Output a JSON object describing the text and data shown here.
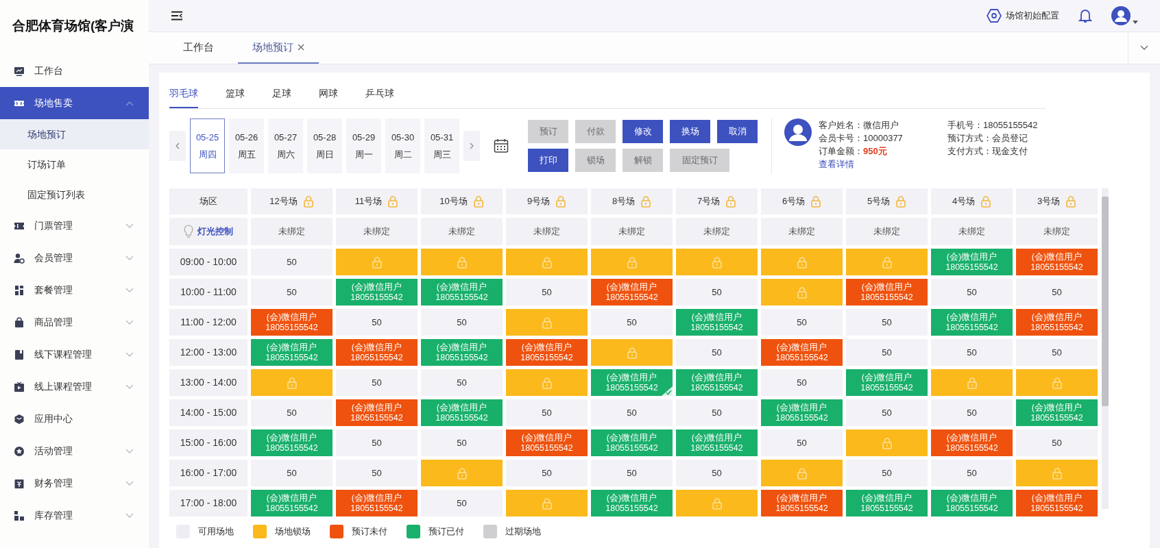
{
  "sidebar": {
    "title": "合肥体育场馆(客户演",
    "items": [
      {
        "label": "工作台",
        "kind": "link",
        "selected": false
      },
      {
        "label": "场地售卖",
        "kind": "group",
        "selected": true,
        "expanded": true,
        "children": [
          {
            "label": "场地预订",
            "selected": true
          },
          {
            "label": "订场订单",
            "selected": false
          },
          {
            "label": "固定预订列表",
            "selected": false
          }
        ]
      },
      {
        "label": "门票管理",
        "kind": "group",
        "selected": false,
        "expanded": false
      },
      {
        "label": "会员管理",
        "kind": "group",
        "selected": false,
        "expanded": false
      },
      {
        "label": "套餐管理",
        "kind": "group",
        "selected": false,
        "expanded": false
      },
      {
        "label": "商品管理",
        "kind": "group",
        "selected": false,
        "expanded": false
      },
      {
        "label": "线下课程管理",
        "kind": "group",
        "selected": false,
        "expanded": false
      },
      {
        "label": "线上课程管理",
        "kind": "group",
        "selected": false,
        "expanded": false
      },
      {
        "label": "应用中心",
        "kind": "link",
        "selected": false
      },
      {
        "label": "活动管理",
        "kind": "group",
        "selected": false,
        "expanded": false
      },
      {
        "label": "财务管理",
        "kind": "group",
        "selected": false,
        "expanded": false
      },
      {
        "label": "库存管理",
        "kind": "group",
        "selected": false,
        "expanded": false
      }
    ]
  },
  "header": {
    "settings_label": "场馆初始配置"
  },
  "tabs": [
    {
      "label": "工作台",
      "selected": false,
      "closable": false
    },
    {
      "label": "场地预订",
      "selected": true,
      "closable": true
    }
  ],
  "sport_tabs": [
    {
      "label": "羽毛球",
      "selected": true
    },
    {
      "label": "篮球",
      "selected": false
    },
    {
      "label": "足球",
      "selected": false
    },
    {
      "label": "网球",
      "selected": false
    },
    {
      "label": "乒乓球",
      "selected": false
    }
  ],
  "dates": [
    {
      "date": "05-25",
      "weekday": "周四",
      "selected": true
    },
    {
      "date": "05-26",
      "weekday": "周五",
      "selected": false
    },
    {
      "date": "05-27",
      "weekday": "周六",
      "selected": false
    },
    {
      "date": "05-28",
      "weekday": "周日",
      "selected": false
    },
    {
      "date": "05-29",
      "weekday": "周一",
      "selected": false
    },
    {
      "date": "05-30",
      "weekday": "周二",
      "selected": false
    },
    {
      "date": "05-31",
      "weekday": "周三",
      "selected": false
    }
  ],
  "action_rows": [
    [
      {
        "label": "预订",
        "disabled": true
      },
      {
        "label": "付款",
        "disabled": true
      },
      {
        "label": "修改",
        "disabled": false
      },
      {
        "label": "换场",
        "disabled": false
      },
      {
        "label": "取消",
        "disabled": false
      }
    ],
    [
      {
        "label": "打印",
        "disabled": false
      },
      {
        "label": "锁场",
        "disabled": true
      },
      {
        "label": "解锁",
        "disabled": true
      },
      {
        "label": "固定预订",
        "disabled": true
      }
    ]
  ],
  "customer": {
    "fields": [
      {
        "label": "客户姓名：",
        "value": "微信用户",
        "emphasis": false
      },
      {
        "label": "会员卡号：",
        "value": "10000377",
        "emphasis": false
      },
      {
        "label": "订单金额：",
        "value": "950元",
        "emphasis": true
      }
    ],
    "fields_right": [
      {
        "label": "手机号：",
        "value": "18055155542"
      },
      {
        "label": "预订方式：",
        "value": "会员登记"
      },
      {
        "label": "支付方式：",
        "value": "现金支付"
      }
    ],
    "details_link": "查看详情"
  },
  "table": {
    "corner": "场区",
    "courts": [
      "12号场",
      "11号场",
      "10号场",
      "9号场",
      "8号场",
      "7号场",
      "6号场",
      "5号场",
      "4号场",
      "3号场"
    ],
    "light_control": {
      "label": "灯光控制",
      "bindings": [
        "未绑定",
        "未绑定",
        "未绑定",
        "未绑定",
        "未绑定",
        "未绑定",
        "未绑定",
        "未绑定",
        "未绑定",
        "未绑定"
      ]
    },
    "rows": [
      {
        "time": "09:00 - 10:00",
        "cells": [
          {
            "kind": "available",
            "price": "50",
            "selected": false
          },
          {
            "kind": "locked",
            "selected": false
          },
          {
            "kind": "locked",
            "selected": false
          },
          {
            "kind": "locked",
            "selected": false
          },
          {
            "kind": "locked",
            "selected": false
          },
          {
            "kind": "locked",
            "selected": false
          },
          {
            "kind": "locked",
            "selected": false
          },
          {
            "kind": "locked",
            "selected": false
          },
          {
            "kind": "paid",
            "name": "(会)微信用户",
            "phone": "18055155542",
            "selected": false
          },
          {
            "kind": "unpaid",
            "name": "(会)微信用户",
            "phone": "18055155542",
            "selected": false
          }
        ]
      },
      {
        "time": "10:00 - 11:00",
        "cells": [
          {
            "kind": "available",
            "price": "50",
            "selected": false
          },
          {
            "kind": "paid",
            "name": "(会)微信用户",
            "phone": "18055155542",
            "selected": false
          },
          {
            "kind": "paid",
            "name": "(会)微信用户",
            "phone": "18055155542",
            "selected": false
          },
          {
            "kind": "available",
            "price": "50",
            "selected": false
          },
          {
            "kind": "unpaid",
            "name": "(会)微信用户",
            "phone": "18055155542",
            "selected": false
          },
          {
            "kind": "available",
            "price": "50",
            "selected": false
          },
          {
            "kind": "locked",
            "selected": false
          },
          {
            "kind": "unpaid",
            "name": "(会)微信用户",
            "phone": "18055155542",
            "selected": false
          },
          {
            "kind": "available",
            "price": "50",
            "selected": false
          },
          {
            "kind": "available",
            "price": "50",
            "selected": false
          }
        ]
      },
      {
        "time": "11:00 - 12:00",
        "cells": [
          {
            "kind": "unpaid",
            "name": "(会)微信用户",
            "phone": "18055155542",
            "selected": false
          },
          {
            "kind": "available",
            "price": "50",
            "selected": false
          },
          {
            "kind": "available",
            "price": "50",
            "selected": false
          },
          {
            "kind": "locked",
            "selected": false
          },
          {
            "kind": "available",
            "price": "50",
            "selected": false
          },
          {
            "kind": "paid",
            "name": "(会)微信用户",
            "phone": "18055155542",
            "selected": false
          },
          {
            "kind": "available",
            "price": "50",
            "selected": false
          },
          {
            "kind": "available",
            "price": "50",
            "selected": false
          },
          {
            "kind": "paid",
            "name": "(会)微信用户",
            "phone": "18055155542",
            "selected": false
          },
          {
            "kind": "unpaid",
            "name": "(会)微信用户",
            "phone": "18055155542",
            "selected": false
          }
        ]
      },
      {
        "time": "12:00 - 13:00",
        "cells": [
          {
            "kind": "paid",
            "name": "(会)微信用户",
            "phone": "18055155542",
            "selected": false
          },
          {
            "kind": "unpaid",
            "name": "(会)微信用户",
            "phone": "18055155542",
            "selected": false
          },
          {
            "kind": "paid",
            "name": "(会)微信用户",
            "phone": "18055155542",
            "selected": false
          },
          {
            "kind": "unpaid",
            "name": "(会)微信用户",
            "phone": "18055155542",
            "selected": false
          },
          {
            "kind": "locked",
            "selected": false
          },
          {
            "kind": "available",
            "price": "50",
            "selected": false
          },
          {
            "kind": "unpaid",
            "name": "(会)微信用户",
            "phone": "18055155542",
            "selected": false
          },
          {
            "kind": "available",
            "price": "50",
            "selected": false
          },
          {
            "kind": "available",
            "price": "50",
            "selected": false
          },
          {
            "kind": "available",
            "price": "50",
            "selected": false
          }
        ]
      },
      {
        "time": "13:00 - 14:00",
        "cells": [
          {
            "kind": "locked",
            "selected": false
          },
          {
            "kind": "available",
            "price": "50",
            "selected": false
          },
          {
            "kind": "available",
            "price": "50",
            "selected": false
          },
          {
            "kind": "locked",
            "selected": false
          },
          {
            "kind": "paid",
            "name": "(会)微信用户",
            "phone": "18055155542",
            "selected": true
          },
          {
            "kind": "paid",
            "name": "(会)微信用户",
            "phone": "18055155542",
            "selected": false
          },
          {
            "kind": "available",
            "price": "50",
            "selected": false
          },
          {
            "kind": "paid",
            "name": "(会)微信用户",
            "phone": "18055155542",
            "selected": false
          },
          {
            "kind": "locked",
            "selected": false
          },
          {
            "kind": "locked",
            "selected": false
          }
        ]
      },
      {
        "time": "14:00 - 15:00",
        "cells": [
          {
            "kind": "available",
            "price": "50",
            "selected": false
          },
          {
            "kind": "unpaid",
            "name": "(会)微信用户",
            "phone": "18055155542",
            "selected": false
          },
          {
            "kind": "paid",
            "name": "(会)微信用户",
            "phone": "18055155542",
            "selected": false
          },
          {
            "kind": "available",
            "price": "50",
            "selected": false
          },
          {
            "kind": "available",
            "price": "50",
            "selected": false
          },
          {
            "kind": "available",
            "price": "50",
            "selected": false
          },
          {
            "kind": "paid",
            "name": "(会)微信用户",
            "phone": "18055155542",
            "selected": false
          },
          {
            "kind": "available",
            "price": "50",
            "selected": false
          },
          {
            "kind": "available",
            "price": "50",
            "selected": false
          },
          {
            "kind": "paid",
            "name": "(会)微信用户",
            "phone": "18055155542",
            "selected": false
          }
        ]
      },
      {
        "time": "15:00 - 16:00",
        "cells": [
          {
            "kind": "paid",
            "name": "(会)微信用户",
            "phone": "18055155542",
            "selected": false
          },
          {
            "kind": "available",
            "price": "50",
            "selected": false
          },
          {
            "kind": "available",
            "price": "50",
            "selected": false
          },
          {
            "kind": "unpaid",
            "name": "(会)微信用户",
            "phone": "18055155542",
            "selected": false
          },
          {
            "kind": "paid",
            "name": "(会)微信用户",
            "phone": "18055155542",
            "selected": false
          },
          {
            "kind": "paid",
            "name": "(会)微信用户",
            "phone": "18055155542",
            "selected": false
          },
          {
            "kind": "available",
            "price": "50",
            "selected": false
          },
          {
            "kind": "locked",
            "selected": false
          },
          {
            "kind": "unpaid",
            "name": "(会)微信用户",
            "phone": "18055155542",
            "selected": false
          },
          {
            "kind": "available",
            "price": "50",
            "selected": false
          }
        ]
      },
      {
        "time": "16:00 - 17:00",
        "cells": [
          {
            "kind": "available",
            "price": "50",
            "selected": false
          },
          {
            "kind": "available",
            "price": "50",
            "selected": false
          },
          {
            "kind": "locked",
            "selected": false
          },
          {
            "kind": "available",
            "price": "50",
            "selected": false
          },
          {
            "kind": "available",
            "price": "50",
            "selected": false
          },
          {
            "kind": "available",
            "price": "50",
            "selected": false
          },
          {
            "kind": "locked",
            "selected": false
          },
          {
            "kind": "available",
            "price": "50",
            "selected": false
          },
          {
            "kind": "available",
            "price": "50",
            "selected": false
          },
          {
            "kind": "locked",
            "selected": false
          }
        ]
      },
      {
        "time": "17:00 - 18:00",
        "cells": [
          {
            "kind": "paid",
            "name": "(会)微信用户",
            "phone": "18055155542",
            "selected": false
          },
          {
            "kind": "unpaid",
            "name": "(会)微信用户",
            "phone": "18055155542",
            "selected": false
          },
          {
            "kind": "available",
            "price": "50",
            "selected": false
          },
          {
            "kind": "locked",
            "selected": false
          },
          {
            "kind": "paid",
            "name": "(会)微信用户",
            "phone": "18055155542",
            "selected": false
          },
          {
            "kind": "locked",
            "selected": false
          },
          {
            "kind": "unpaid",
            "name": "(会)微信用户",
            "phone": "18055155542",
            "selected": false
          },
          {
            "kind": "paid",
            "name": "(会)微信用户",
            "phone": "18055155542",
            "selected": false
          },
          {
            "kind": "paid",
            "name": "(会)微信用户",
            "phone": "18055155542",
            "selected": false
          },
          {
            "kind": "unpaid",
            "name": "(会)微信用户",
            "phone": "18055155542",
            "selected": false
          }
        ]
      }
    ]
  },
  "legend": [
    {
      "label": "可用场地",
      "color": "#eeedf3"
    },
    {
      "label": "场地锁场",
      "color": "#fbb91c"
    },
    {
      "label": "预订未付",
      "color": "#ef520e"
    },
    {
      "label": "预订已付",
      "color": "#19b06b"
    },
    {
      "label": "过期场地",
      "color": "#cfcfd1"
    }
  ]
}
